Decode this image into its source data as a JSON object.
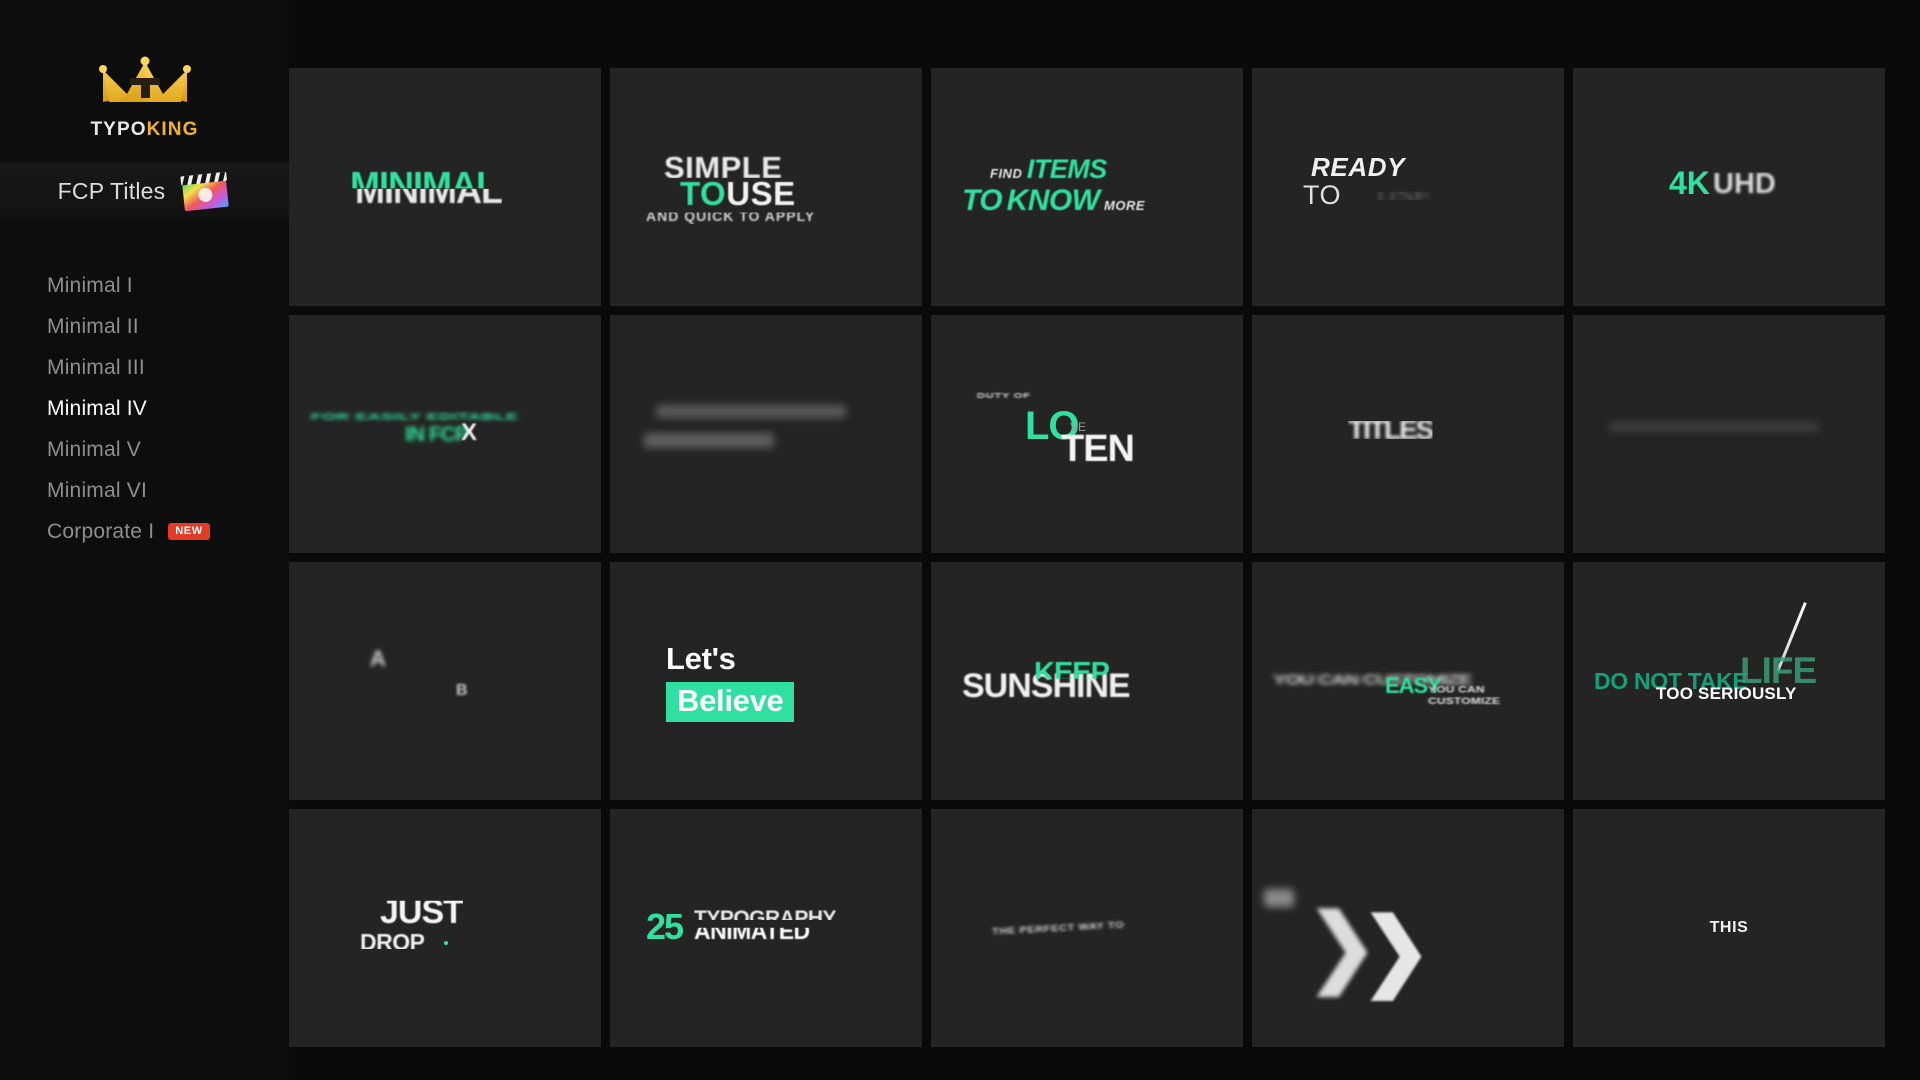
{
  "brand": {
    "logo_icon": "crown-icon",
    "name_part1": "TYPO",
    "name_part2": "KING",
    "accent_color": "#f0b323"
  },
  "product_row": {
    "label": "FCP Titles",
    "icon": "final-cut-pro-clapperboard-icon"
  },
  "sidebar": {
    "items": [
      {
        "label": "Minimal I",
        "active": false,
        "badge": ""
      },
      {
        "label": "Minimal II",
        "active": false,
        "badge": ""
      },
      {
        "label": "Minimal III",
        "active": false,
        "badge": ""
      },
      {
        "label": "Minimal IV",
        "active": true,
        "badge": ""
      },
      {
        "label": "Minimal V",
        "active": false,
        "badge": ""
      },
      {
        "label": "Minimal VI",
        "active": false,
        "badge": ""
      },
      {
        "label": "Corporate I",
        "active": false,
        "badge": "NEW"
      }
    ],
    "badge_color": "#e23b27"
  },
  "theme": {
    "page_background": "#0a0a0a",
    "sidebar_background": "#0d0d0d",
    "card_background": "#242424",
    "accent_green": "#2fe0a0",
    "text_primary": "#ffffff",
    "text_muted": "#8e8e8e"
  },
  "grid": {
    "columns": 5,
    "rows": 4,
    "cards": [
      {
        "id": 1,
        "name": "minimal",
        "lines": [
          "MINIMAL"
        ]
      },
      {
        "id": 2,
        "name": "simple-to-use",
        "lines": [
          "SIMPLE",
          "TO",
          "USE",
          "AND QUICK TO APPLY"
        ]
      },
      {
        "id": 3,
        "name": "find-items",
        "lines": [
          "FIND",
          "ITEMS",
          "TO",
          "KNOW",
          "MORE"
        ]
      },
      {
        "id": 4,
        "name": "ready-to",
        "lines": [
          "READY",
          "TO",
          "USE"
        ]
      },
      {
        "id": 5,
        "name": "four-k",
        "lines": [
          "4K",
          "UHD"
        ]
      },
      {
        "id": 6,
        "name": "editable-motion",
        "lines": [
          "FOR EASILY EDITABLE",
          "IN FCP",
          "X"
        ]
      },
      {
        "id": 7,
        "name": "blurred-lines",
        "lines": []
      },
      {
        "id": 8,
        "name": "duty-of-love",
        "lines": [
          "DUTY OF",
          "LO",
          "VE",
          "TEN"
        ]
      },
      {
        "id": 9,
        "name": "motion-word",
        "lines": [
          "TITLES"
        ]
      },
      {
        "id": 10,
        "name": "fading-line",
        "lines": []
      },
      {
        "id": 11,
        "name": "letter-fragments",
        "lines": [
          "A",
          "B"
        ]
      },
      {
        "id": 12,
        "name": "lets-believe",
        "lines": [
          "Let's",
          "Believe"
        ]
      },
      {
        "id": 13,
        "name": "keep-sunshine",
        "lines": [
          "SUNSHINE",
          "KEEP"
        ]
      },
      {
        "id": 14,
        "name": "easy-to-customize",
        "lines": [
          "EASY",
          "YOU CAN CUSTOMIZE"
        ]
      },
      {
        "id": 15,
        "name": "do-not-take-life",
        "lines": [
          "DO NOT TAKE",
          "LIFE",
          "TOO SERIOUSLY"
        ]
      },
      {
        "id": 16,
        "name": "just-drop",
        "lines": [
          "JUST",
          "DROP"
        ]
      },
      {
        "id": 17,
        "name": "twentyfive-typography",
        "lines": [
          "25",
          "TYPOGRAPHY",
          "ANIMATED"
        ]
      },
      {
        "id": 18,
        "name": "small-caption",
        "lines": [
          "THE PERFECT WAY TO"
        ]
      },
      {
        "id": 19,
        "name": "chevron-motion",
        "lines": []
      },
      {
        "id": 20,
        "name": "this",
        "lines": [
          "THIS"
        ]
      }
    ]
  }
}
